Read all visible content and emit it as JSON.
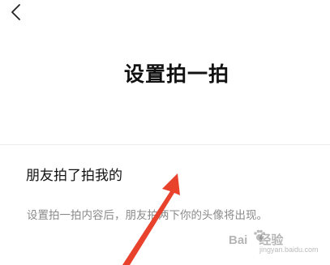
{
  "header": {
    "back_icon": "chevron-left-icon",
    "title": "设置拍一拍"
  },
  "form": {
    "value": "朋友拍了拍我的",
    "hint": "设置拍一拍内容后，朋友拍两下你的头像将出现。"
  },
  "annotation": {
    "arrow_color": "#e8412c"
  },
  "watermark": {
    "brand": "Bai",
    "brand_suffix": "经验",
    "domain": "jingyan.baidu.com"
  }
}
